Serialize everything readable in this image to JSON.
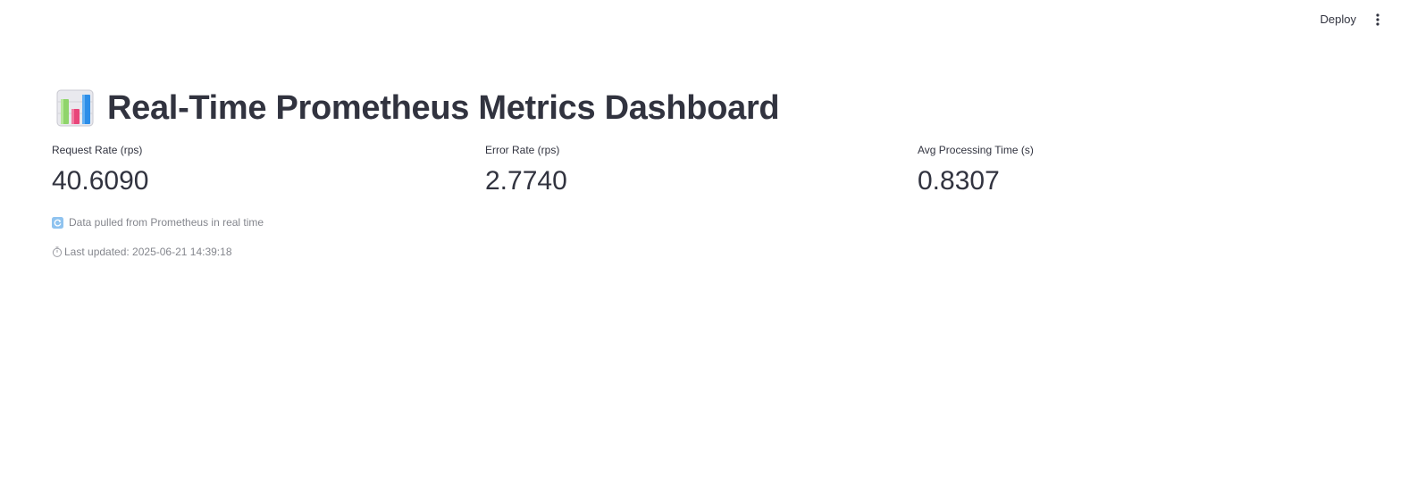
{
  "header": {
    "deploy_label": "Deploy",
    "menu_icon": "more-vertical-icon"
  },
  "page": {
    "title_icon": "bar-chart-emoji-icon",
    "title": "Real-Time Prometheus Metrics Dashboard"
  },
  "metrics": [
    {
      "label": "Request Rate (rps)",
      "value": "40.6090"
    },
    {
      "label": "Error Rate (rps)",
      "value": "2.7740"
    },
    {
      "label": "Avg Processing Time (s)",
      "value": "0.8307"
    }
  ],
  "captions": {
    "data_source_icon": "refresh-icon",
    "data_source": "Data pulled from Prometheus in real time",
    "last_updated_icon": "stopwatch-icon",
    "last_updated": "Last updated: 2025-06-21 14:39:18"
  },
  "colors": {
    "text": "#31333f",
    "caption": "#8c8d94",
    "background": "#ffffff"
  }
}
